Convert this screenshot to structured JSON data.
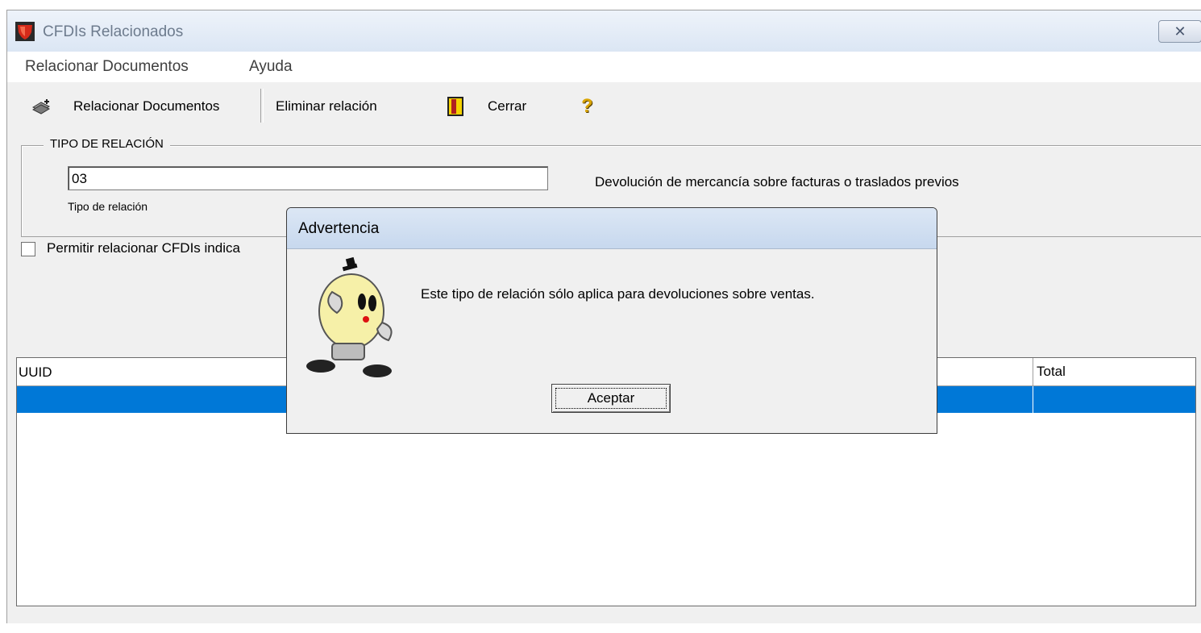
{
  "window": {
    "title": "CFDIs Relacionados",
    "close_label": "✕"
  },
  "menu": {
    "items": [
      "Relacionar Documentos",
      "Ayuda"
    ]
  },
  "toolbar": {
    "relate": "Relacionar Documentos",
    "delete": "Eliminar relación",
    "close": "Cerrar",
    "help": "?"
  },
  "relation": {
    "group_title": "TIPO DE RELACIÓN",
    "value": "03",
    "label": "Tipo de relación",
    "description": "Devolución de mercancía sobre facturas o traslados previos"
  },
  "checkbox": {
    "label": "Permitir relacionar CFDIs indica",
    "checked": false
  },
  "grid": {
    "columns": [
      "UUID",
      "Total"
    ]
  },
  "dialog": {
    "title": "Advertencia",
    "message": "Este tipo de relación sólo aplica para devoluciones sobre ventas.",
    "ok": "Aceptar"
  },
  "colors": {
    "selection": "#0078d7",
    "window_bg": "#f0f0f0",
    "title_text": "#6d7b8d"
  }
}
